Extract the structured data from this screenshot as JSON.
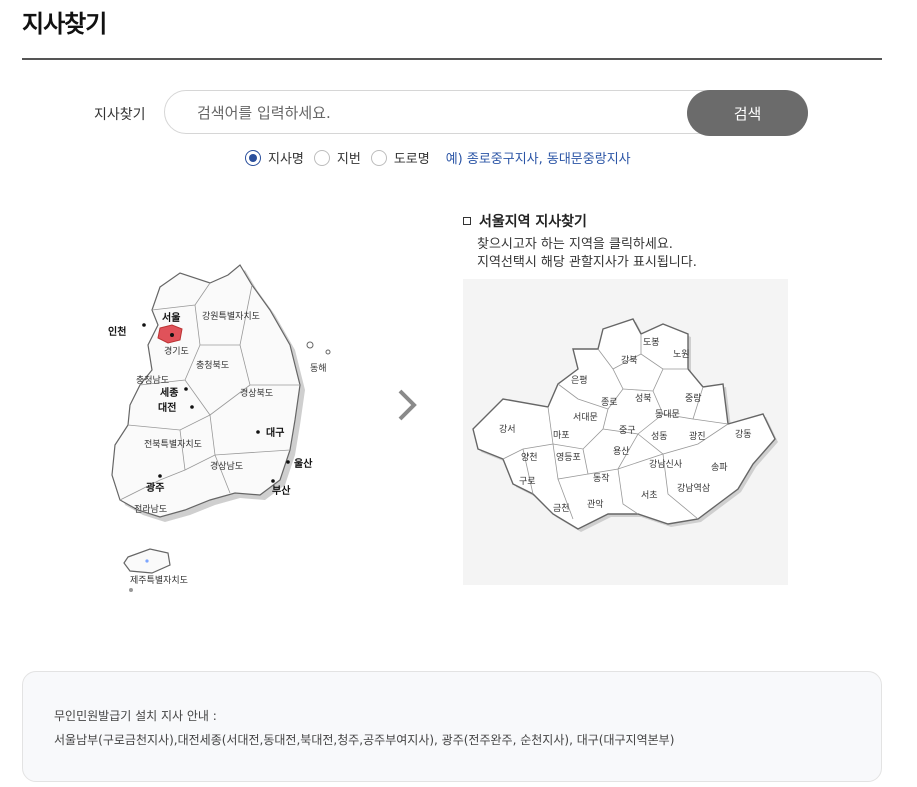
{
  "page": {
    "title": "지사찾기"
  },
  "search": {
    "label": "지사찾기",
    "placeholder": "검색어를 입력하세요.",
    "value": "",
    "button_label": "검색"
  },
  "search_options": {
    "options": [
      {
        "label": "지사명",
        "checked": true
      },
      {
        "label": "지번",
        "checked": false
      },
      {
        "label": "도로명",
        "checked": false
      }
    ],
    "example": "예) 종로중구지사, 동대문중랑지사"
  },
  "korea_map": {
    "regions": [
      "서울",
      "인천",
      "경기도",
      "강원특별자치도",
      "충청북도",
      "충청남도",
      "세종",
      "대전",
      "경상북도",
      "대구",
      "전북특별자치도",
      "경상남도",
      "울산",
      "부산",
      "광주",
      "전라남도",
      "제주특별자치도",
      "동해"
    ],
    "highlight_color": "#e0525a"
  },
  "seoul_section": {
    "heading": "서울지역 지사찾기",
    "desc_line1": "찾으시고자 하는 지역을 클릭하세요.",
    "desc_line2": "지역선택시 해당 관할지사가 표시됩니다.",
    "districts": [
      "도봉",
      "노원",
      "강북",
      "은평",
      "성북",
      "중랑",
      "종로",
      "서대문",
      "동대문",
      "강서",
      "마포",
      "중구",
      "성동",
      "광진",
      "강동",
      "양천",
      "영등포",
      "용산",
      "강남신사",
      "송파",
      "구로",
      "동작",
      "서초",
      "강남역삼",
      "금천",
      "관악"
    ]
  },
  "notice": {
    "title": "무인민원발급기 설치 지사 안내 :",
    "text": "서울남부(구로금천지사),대전세종(서대전,동대전,북대전,청주,공주부여지사), 광주(전주완주, 순천지사), 대구(대구지역본부)"
  }
}
